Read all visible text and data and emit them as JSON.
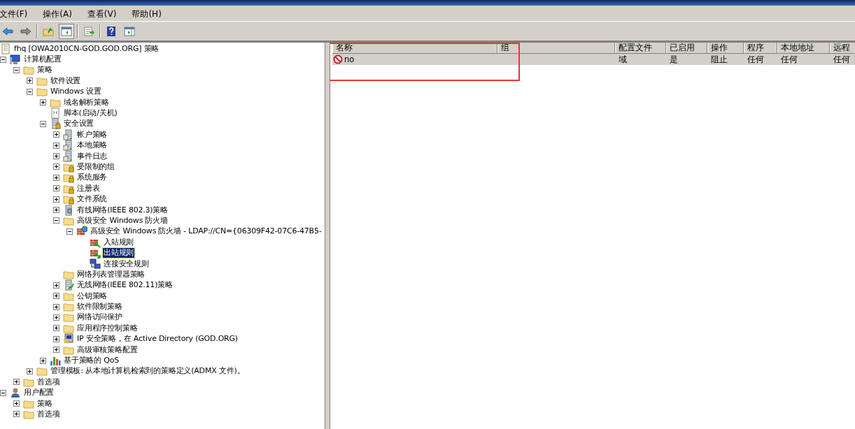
{
  "menu_bar": [
    {
      "label": "文件(F)"
    },
    {
      "label": "操作(A)"
    },
    {
      "label": "查看(V)"
    },
    {
      "label": "帮助(H)"
    }
  ],
  "toolbar": [
    {
      "kind": "back"
    },
    {
      "kind": "forward"
    },
    {
      "kind": "sep"
    },
    {
      "kind": "up",
      "pressed": false
    },
    {
      "kind": "tree",
      "pressed": true
    },
    {
      "kind": "sep"
    },
    {
      "kind": "export",
      "pressed": false
    },
    {
      "kind": "sep"
    },
    {
      "kind": "help",
      "pressed": false
    },
    {
      "kind": "pane",
      "pressed": false
    }
  ],
  "tree": [
    {
      "label": "fhq [OWA2010CN-GOD.GOD.ORG] 策略",
      "kind": "document",
      "selected": false,
      "children": [
        {
          "label": "计算机配置",
          "kind": "computer",
          "expanded": true,
          "selected": false,
          "children": [
            {
              "label": "策略",
              "kind": "folder",
              "expanded": true,
              "selected": false,
              "children": [
                {
                  "label": "软件设置",
                  "kind": "folder",
                  "expanded": false,
                  "selected": false
                },
                {
                  "label": "Windows 设置",
                  "kind": "folder",
                  "expanded": true,
                  "selected": false,
                  "children": [
                    {
                      "label": "域名解析策略",
                      "kind": "folder",
                      "expanded": false,
                      "selected": false
                    },
                    {
                      "label": "脚本(启动/关机)",
                      "kind": "script",
                      "selected": false
                    },
                    {
                      "label": "安全设置",
                      "kind": "lock-server",
                      "expanded": true,
                      "selected": false,
                      "children": [
                        {
                          "label": "帐户策略",
                          "kind": "server",
                          "expanded": false,
                          "selected": false
                        },
                        {
                          "label": "本地策略",
                          "kind": "server",
                          "expanded": false,
                          "selected": false
                        },
                        {
                          "label": "事件日志",
                          "kind": "server",
                          "expanded": false,
                          "selected": false
                        },
                        {
                          "label": "受限制的组",
                          "kind": "lock-folder",
                          "expanded": false,
                          "selected": false
                        },
                        {
                          "label": "系统服务",
                          "kind": "lock-folder",
                          "expanded": false,
                          "selected": false
                        },
                        {
                          "label": "注册表",
                          "kind": "lock-folder",
                          "expanded": false,
                          "selected": false
                        },
                        {
                          "label": "文件系统",
                          "kind": "lock-folder",
                          "expanded": false,
                          "selected": false
                        },
                        {
                          "label": "有线网络(IEEE 802.3)策略",
                          "kind": "wired",
                          "expanded": false,
                          "selected": false
                        },
                        {
                          "label": "高级安全 Windows 防火墙",
                          "kind": "folder",
                          "expanded": true,
                          "selected": false,
                          "children": [
                            {
                              "label": "高级安全 Windows 防火墙 - LDAP://CN={06309F42-07C6-47B5-",
                              "kind": "firewall",
                              "expanded": true,
                              "selected": false,
                              "children": [
                                {
                                  "label": "入站规则",
                                  "kind": "inbound",
                                  "selected": false
                                },
                                {
                                  "label": "出站规则",
                                  "kind": "outbound",
                                  "selected": true
                                },
                                {
                                  "label": "连接安全规则",
                                  "kind": "connection",
                                  "selected": false
                                }
                              ]
                            }
                          ]
                        },
                        {
                          "label": "网络列表管理器策略",
                          "kind": "folder",
                          "selected": false
                        },
                        {
                          "label": "无线网络(IEEE 802.11)策略",
                          "kind": "wireless",
                          "expanded": false,
                          "selected": false
                        },
                        {
                          "label": "公钥策略",
                          "kind": "folder",
                          "expanded": false,
                          "selected": false
                        },
                        {
                          "label": "软件限制策略",
                          "kind": "folder",
                          "expanded": false,
                          "selected": false
                        },
                        {
                          "label": "网络访问保护",
                          "kind": "folder",
                          "expanded": false,
                          "selected": false
                        },
                        {
                          "label": "应用程序控制策略",
                          "kind": "folder",
                          "expanded": false,
                          "selected": false
                        },
                        {
                          "label": "IP 安全策略，在 Active Directory (GOD.ORG)",
                          "kind": "ip-security",
                          "expanded": false,
                          "selected": false
                        },
                        {
                          "label": "高级审核策略配置",
                          "kind": "folder",
                          "expanded": false,
                          "selected": false
                        }
                      ]
                    },
                    {
                      "label": "基于策略的 QoS",
                      "kind": "qos",
                      "expanded": false,
                      "selected": false
                    }
                  ]
                },
                {
                  "label": "管理模板: 从本地计算机检索到的策略定义(ADMX 文件)。",
                  "kind": "folder",
                  "expanded": false,
                  "selected": false
                }
              ]
            },
            {
              "label": "首选项",
              "kind": "folder",
              "expanded": false,
              "selected": false
            }
          ]
        },
        {
          "label": "用户配置",
          "kind": "user",
          "expanded": true,
          "selected": false,
          "children": [
            {
              "label": "策略",
              "kind": "folder",
              "expanded": false,
              "selected": false
            },
            {
              "label": "首选项",
              "kind": "folder",
              "expanded": false,
              "selected": false
            }
          ]
        }
      ]
    }
  ],
  "table": {
    "columns": [
      "名称",
      "组",
      "配置文件",
      "已启用",
      "操作",
      "程序",
      "本地地址",
      "远程"
    ],
    "rows": [
      {
        "kind": "blocked",
        "selected": true,
        "cells": [
          "no",
          "",
          "域",
          "是",
          "阻止",
          "任何",
          "任何",
          "任何"
        ]
      }
    ]
  }
}
